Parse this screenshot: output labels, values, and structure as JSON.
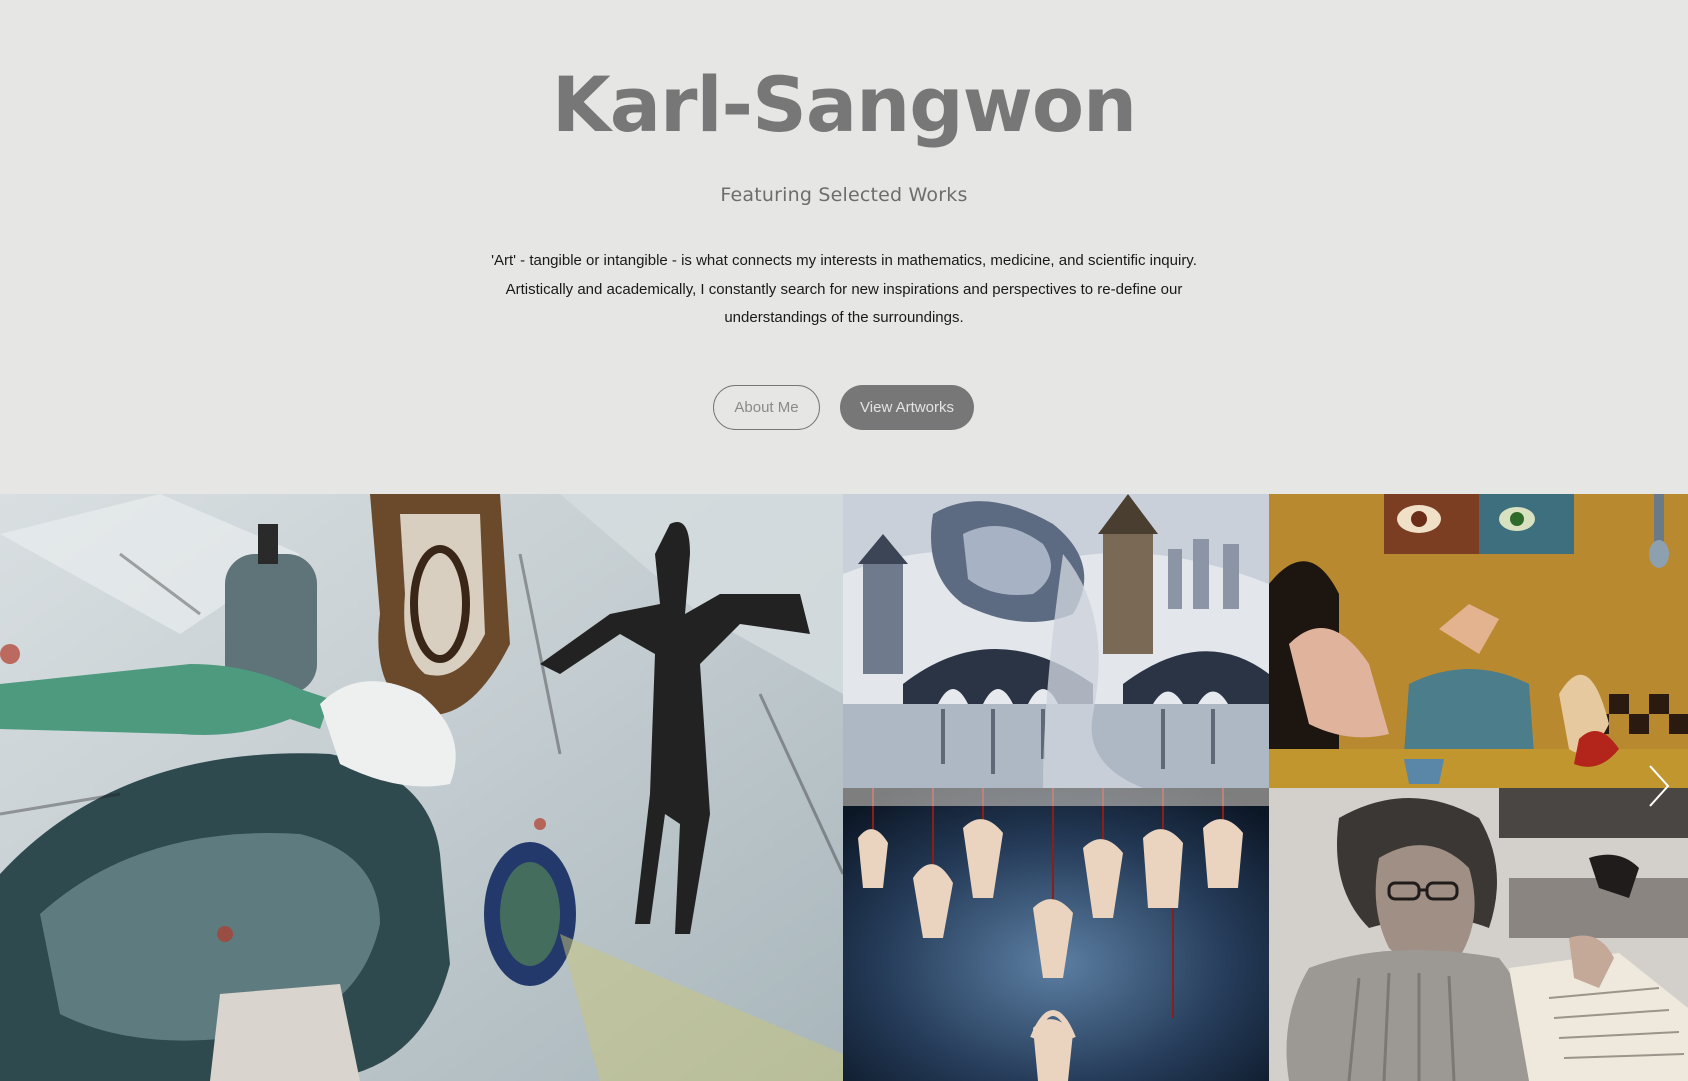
{
  "header": {
    "title": "Karl-Sangwon",
    "subtitle": "Featuring Selected Works",
    "intro_lines": [
      "'Art' - tangible or intangible - is what connects my interests in mathematics, medicine, and scientific inquiry.",
      "Artistically and academically, I constantly search for new inspirations and perspectives to re-define our",
      "understandings of the surroundings."
    ]
  },
  "buttons": {
    "about_label": "About Me",
    "view_label": "View Artworks"
  },
  "gallery": {
    "next_icon": "chevron-right-icon",
    "artworks": [
      {
        "name": "artwork-abstract-figures",
        "palette": [
          "#c9d3d6",
          "#3e5d62",
          "#1b1b1b",
          "#6b4a2c"
        ]
      },
      {
        "name": "artwork-monochrome-bridge",
        "palette": [
          "#d4dae1",
          "#2f3a4c",
          "#7b8598",
          "#0f131b"
        ]
      },
      {
        "name": "artwork-surreal-table",
        "palette": [
          "#b88a2c",
          "#4b7d8a",
          "#e3b8a2",
          "#6b2316"
        ]
      },
      {
        "name": "artwork-marionettes",
        "palette": [
          "#0f1d2e",
          "#3c5b7a",
          "#e9d4c1",
          "#8a1f1a"
        ]
      },
      {
        "name": "artwork-reading-woman",
        "palette": [
          "#cfcbc5",
          "#58534f",
          "#1f1c1b",
          "#e6ded4"
        ]
      }
    ]
  }
}
